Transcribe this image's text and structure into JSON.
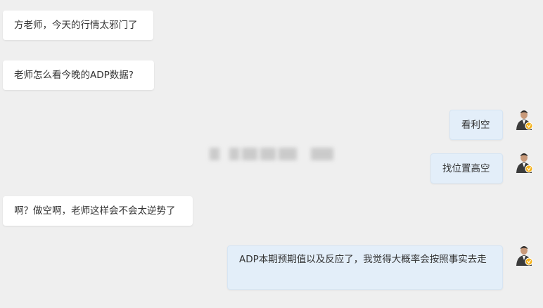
{
  "messages": [
    {
      "side": "left",
      "text": "方老师，今天的行情太邪门了"
    },
    {
      "side": "left",
      "text": "老师怎么看今晚的ADP数据?"
    },
    {
      "side": "right",
      "text": "看利空"
    },
    {
      "side": "right",
      "text": "找位置高空"
    },
    {
      "side": "left",
      "text": "啊？做空啊，老师这样会不会太逆势了"
    },
    {
      "side": "right",
      "text": "ADP本期预期值以及反应了，我觉得大概率会按照事实去走"
    }
  ],
  "colors": {
    "background": "#efefef",
    "left_bubble": "#ffffff",
    "right_bubble": "#e3eef9",
    "verified_badge": "#f5b21a"
  },
  "icons": {
    "avatar": "teacher-avatar-icon",
    "badge": "verified-badge-icon"
  }
}
